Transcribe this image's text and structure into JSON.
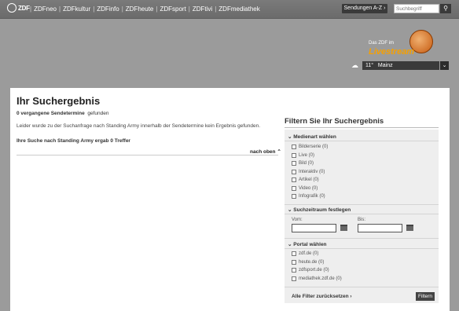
{
  "logo": "ZDF",
  "nav": [
    "ZDFneo",
    "ZDFkultur",
    "ZDFinfo",
    "ZDFheute",
    "ZDFsport",
    "ZDFtivi",
    "ZDFmediathek"
  ],
  "sendungen_label": "Sendungen A-Z",
  "search_placeholder": "Suchbegriff",
  "livestream": {
    "small": "Das ZDF im",
    "big": "Livestream"
  },
  "weather": {
    "temp": "11°",
    "city": "Mainz"
  },
  "page_title": "Ihr Suchergebnis",
  "count_bold": "0 vergangene Sendetermine",
  "count_rest": "gefunden",
  "message": "Leider wurde zu der Suchanfrage nach Standing Army innerhalb der Sendetermine kein Ergebnis gefunden.",
  "result_line": "Ihre Suche nach Standing Army ergab 0 Treffer",
  "top_link": "nach oben",
  "filter": {
    "title": "Filtern Sie Ihr Suchergebnis",
    "media_head": "Medienart wählen",
    "media": [
      "Bilderserie (0)",
      "Live (0)",
      "Bild (0)",
      "Interaktiv (0)",
      "Artikel (0)",
      "Video (0)",
      "Infografik (0)"
    ],
    "period_head": "Suchzeitraum festlegen",
    "from_label": "Vom:",
    "to_label": "Bis:",
    "portal_head": "Portal wählen",
    "portals": [
      "zdf.de (0)",
      "heute.de (0)",
      "zdfsport.de (0)",
      "mediathek.zdf.de (0)"
    ],
    "reset": "Alle Filter zurücksetzen",
    "button": "Filtern"
  }
}
